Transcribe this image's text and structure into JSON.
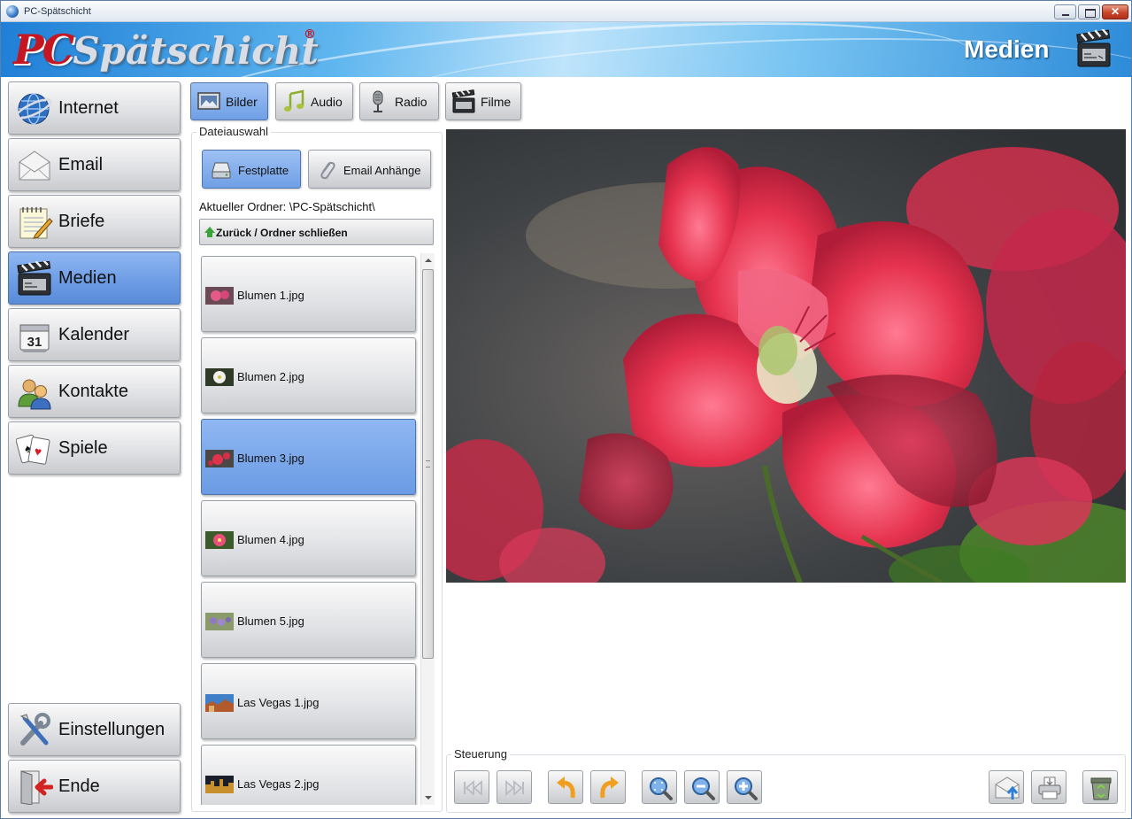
{
  "window": {
    "title": "PC-Spätschicht"
  },
  "header": {
    "logo_pc": "PC",
    "logo_rest": "Spätschicht",
    "logo_reg": "®",
    "section": "Medien"
  },
  "nav": {
    "items": [
      {
        "label": "Internet",
        "icon": "globe-icon"
      },
      {
        "label": "Email",
        "icon": "envelope-icon"
      },
      {
        "label": "Briefe",
        "icon": "notepad-icon"
      },
      {
        "label": "Medien",
        "icon": "clapperboard-icon",
        "active": true
      },
      {
        "label": "Kalender",
        "icon": "calendar-icon"
      },
      {
        "label": "Kontakte",
        "icon": "people-icon"
      },
      {
        "label": "Spiele",
        "icon": "playing-cards-icon"
      }
    ],
    "settings_label": "Einstellungen",
    "exit_label": "Ende"
  },
  "tabs": [
    {
      "label": "Bilder",
      "icon": "picture-icon",
      "active": true
    },
    {
      "label": "Audio",
      "icon": "music-note-icon"
    },
    {
      "label": "Radio",
      "icon": "microphone-icon"
    },
    {
      "label": "Filme",
      "icon": "film-clapper-icon"
    }
  ],
  "file_selection": {
    "group_label": "Dateiauswahl",
    "source_harddisk": "Festplatte",
    "source_email": "Email Anhänge",
    "current_folder": "Aktueller Ordner: \\PC-Spätschicht\\",
    "back_button": "Zurück / Ordner schließen",
    "files": [
      {
        "name": "Blumen 1.jpg"
      },
      {
        "name": "Blumen 2.jpg"
      },
      {
        "name": "Blumen 3.jpg",
        "selected": true
      },
      {
        "name": "Blumen 4.jpg"
      },
      {
        "name": "Blumen 5.jpg"
      },
      {
        "name": "Las Vegas 1.jpg"
      },
      {
        "name": "Las Vegas 2.jpg"
      }
    ]
  },
  "controls": {
    "group_label": "Steuerung",
    "buttons": [
      "first-icon",
      "last-icon",
      "rotate-left-icon",
      "rotate-right-icon",
      "zoom-fit-icon",
      "zoom-out-icon",
      "zoom-in-icon",
      "send-email-icon",
      "print-icon",
      "recycle-bin-icon"
    ]
  },
  "colors": {
    "accent": "#6b9be4",
    "logo_red": "#c51722",
    "banner": "#2d8bd8"
  }
}
